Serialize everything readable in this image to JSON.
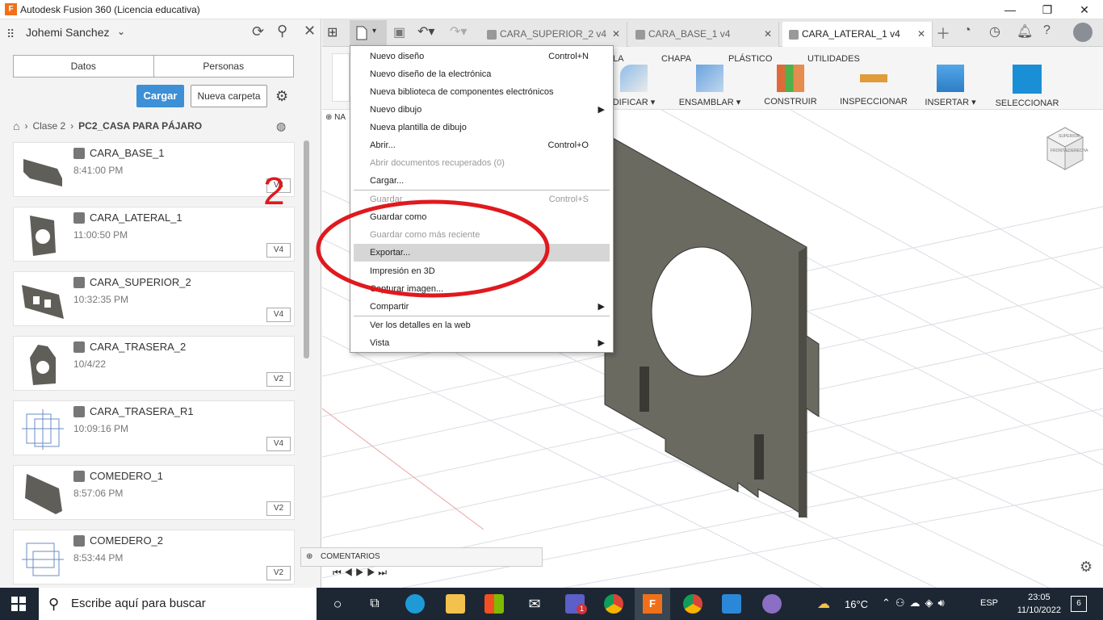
{
  "window": {
    "title": "Autodesk Fusion 360 (Licencia educativa)",
    "app_icon": "F"
  },
  "panel": {
    "user": "Johemi Sanchez",
    "tabs": [
      "Datos",
      "Personas"
    ],
    "upload_label": "Cargar",
    "new_folder_label": "Nueva carpeta",
    "breadcrumb": [
      "Clase 2",
      "PC2_CASA PARA PÁJARO"
    ],
    "annotation_number": "2",
    "items": [
      {
        "name": "CARA_BASE_1",
        "time": "8:41:00 PM",
        "version": "V4"
      },
      {
        "name": "CARA_LATERAL_1",
        "time": "11:00:50 PM",
        "version": "V4"
      },
      {
        "name": "CARA_SUPERIOR_2",
        "time": "10:32:35 PM",
        "version": "V4"
      },
      {
        "name": "CARA_TRASERA_2",
        "time": "10/4/22",
        "version": "V2"
      },
      {
        "name": "CARA_TRASERA_R1",
        "time": "10:09:16 PM",
        "version": "V4"
      },
      {
        "name": "COMEDERO_1",
        "time": "8:57:06 PM",
        "version": "V2"
      },
      {
        "name": "COMEDERO_2",
        "time": "8:53:44 PM",
        "version": "V2"
      }
    ]
  },
  "doc_tabs": [
    {
      "label": "CARA_SUPERIOR_2 v4",
      "active": false
    },
    {
      "label": "CARA_BASE_1 v4",
      "active": false
    },
    {
      "label": "CARA_LATERAL_1 v4",
      "active": true
    }
  ],
  "toolbar": {
    "tab_labels": [
      "LA",
      "CHAPA",
      "PLÁSTICO",
      "UTILIDADES"
    ],
    "tools": [
      "DIFICAR ▾",
      "ENSAMBLAR ▾",
      "CONSTRUIR ▾",
      "INSPECCIONAR ▾",
      "INSERTAR ▾",
      "SELECCIONAR ▾"
    ],
    "browser_label": "NA"
  },
  "file_menu": {
    "items": [
      {
        "label": "Nuevo diseño",
        "shortcut": "Control+N",
        "disabled": false
      },
      {
        "label": "Nuevo diseño de la electrónica",
        "shortcut": "",
        "disabled": false
      },
      {
        "label": "Nueva biblioteca de componentes electrónicos",
        "shortcut": "",
        "disabled": false
      },
      {
        "label": "Nuevo dibujo",
        "shortcut": "",
        "disabled": false,
        "submenu": "▶"
      },
      {
        "label": "Nueva plantilla de dibujo",
        "shortcut": "",
        "disabled": false
      },
      {
        "label": "Abrir...",
        "shortcut": "Control+O",
        "disabled": false
      },
      {
        "label": "Abrir documentos recuperados (0)",
        "shortcut": "",
        "disabled": true
      },
      {
        "label": "Cargar...",
        "shortcut": "",
        "disabled": false
      },
      {
        "label": "Guardar",
        "shortcut": "Control+S",
        "disabled": true
      },
      {
        "label": "Guardar como",
        "shortcut": "",
        "disabled": false
      },
      {
        "label": "Guardar como más reciente",
        "shortcut": "",
        "disabled": true
      },
      {
        "label": "Exportar...",
        "shortcut": "",
        "disabled": false,
        "highlighted": true
      },
      {
        "label": "Impresión en 3D",
        "shortcut": "",
        "disabled": false
      },
      {
        "label": "Capturar imagen...",
        "shortcut": "",
        "disabled": false
      },
      {
        "label": "Compartir",
        "shortcut": "",
        "disabled": false,
        "submenu": "▶"
      },
      {
        "label": "Ver los detalles en la web",
        "shortcut": "",
        "disabled": false
      },
      {
        "label": "Vista",
        "shortcut": "",
        "disabled": false,
        "submenu": "▶"
      }
    ]
  },
  "comments_label": "COMENTARIOS",
  "viewcube": {
    "front": "FRONTAL",
    "right": "DERECHA",
    "top": "SUPERIOR"
  },
  "taskbar": {
    "search_placeholder": "Escribe aquí para buscar",
    "weather": "16°C",
    "lang": "ESP",
    "time": "23:05",
    "date": "11/10/2022",
    "notif_count": "6",
    "teams_badge": "1"
  },
  "colors": {
    "accent": "#3d8fd6",
    "annotation": "#e0191e",
    "model": "#6b6a61",
    "taskbar": "#1c2733"
  }
}
